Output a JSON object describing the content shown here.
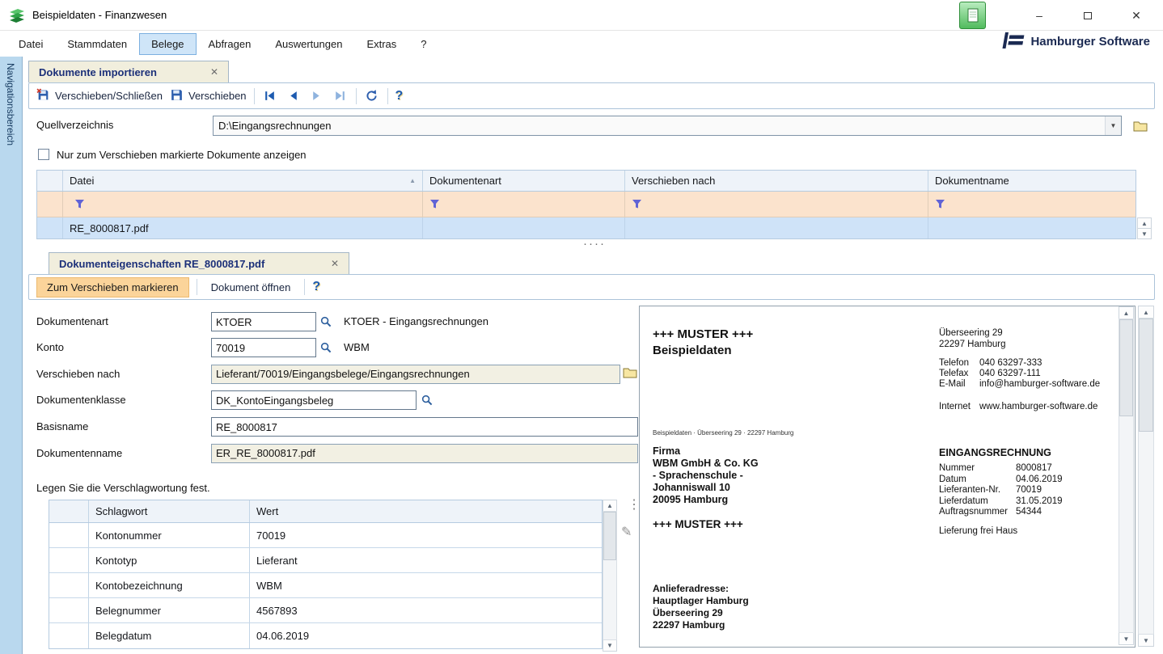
{
  "titlebar": {
    "title": "Beispieldaten - Finanzwesen"
  },
  "menubar": {
    "items": [
      "Datei",
      "Stammdaten",
      "Belege",
      "Abfragen",
      "Auswertungen",
      "Extras",
      "?"
    ]
  },
  "brand": {
    "name": "Hamburger Software"
  },
  "navigation": {
    "label": "Navigationsbereich"
  },
  "import_tab": {
    "title": "Dokumente importieren"
  },
  "toolbar": {
    "move_close_label": "Verschieben/Schließen",
    "move_label": "Verschieben"
  },
  "source_dir": {
    "label": "Quellverzeichnis",
    "value": "D:\\Eingangsrechnungen"
  },
  "show_marked_only": {
    "label": "Nur zum Verschieben markierte Dokumente anzeigen"
  },
  "documents_grid": {
    "columns": {
      "file": "Datei",
      "doc_type": "Dokumentenart",
      "move_to": "Verschieben nach",
      "doc_name": "Dokumentname"
    },
    "rows": [
      {
        "file": "RE_8000817.pdf",
        "doc_type": "",
        "move_to": "",
        "doc_name": ""
      }
    ]
  },
  "properties_tab": {
    "title": "Dokumenteigenschaften RE_8000817.pdf"
  },
  "properties_toolbar": {
    "mark_label": "Zum Verschieben markieren",
    "open_label": "Dokument öffnen"
  },
  "properties_form": {
    "doc_type": {
      "label": "Dokumentenart",
      "value": "KTOER",
      "description": "KTOER - Eingangsrechnungen"
    },
    "account": {
      "label": "Konto",
      "value": "70019",
      "description": "WBM"
    },
    "move_to": {
      "label": "Verschieben nach",
      "value": "Lieferant/70019/Eingangsbelege/Eingangsrechnungen"
    },
    "doc_class": {
      "label": "Dokumentenklasse",
      "value": "DK_KontoEingangsbeleg"
    },
    "base_name": {
      "label": "Basisname",
      "value": "RE_8000817"
    },
    "doc_name": {
      "label": "Dokumentenname",
      "value": "ER_RE_8000817.pdf"
    },
    "keywords_heading": "Legen Sie die Verschlagwortung fest."
  },
  "keywords_grid": {
    "columns": {
      "keyword": "Schlagwort",
      "value": "Wert"
    },
    "rows": [
      {
        "keyword": "Kontonummer",
        "value": "70019"
      },
      {
        "keyword": "Kontotyp",
        "value": "Lieferant"
      },
      {
        "keyword": "Kontobezeichnung",
        "value": "WBM"
      },
      {
        "keyword": "Belegnummer",
        "value": "4567893"
      },
      {
        "keyword": "Belegdatum",
        "value": "04.06.2019"
      }
    ]
  },
  "document_preview": {
    "watermark_top": "+++ MUSTER +++",
    "company": "Beispieldaten",
    "address": [
      "Überseering 29",
      "22297 Hamburg"
    ],
    "contact": [
      {
        "label": "Telefon",
        "value": "040 63297-333"
      },
      {
        "label": "Telefax",
        "value": "040 63297-111"
      },
      {
        "label": "E-Mail",
        "value": "info@hamburger-software.de"
      },
      {
        "label": "Internet",
        "value": "www.hamburger-software.de"
      }
    ],
    "sender_line": "Beispieldaten · Überseering 29 · 22297 Hamburg",
    "recipient": [
      "Firma",
      "WBM GmbH & Co. KG",
      "- Sprachenschule -",
      "Johanniswall 10",
      "20095 Hamburg"
    ],
    "watermark_mid": "+++ MUSTER +++",
    "invoice": {
      "title": "EINGANGSRECHNUNG",
      "fields": [
        {
          "label": "Nummer",
          "value": "8000817"
        },
        {
          "label": "Datum",
          "value": "04.06.2019"
        },
        {
          "label": "Lieferanten-Nr.",
          "value": "70019"
        },
        {
          "label": "Lieferdatum",
          "value": "31.05.2019"
        },
        {
          "label": "Auftragsnummer",
          "value": "54344"
        }
      ],
      "note": "Lieferung frei Haus"
    },
    "delivery_address": [
      "Anlieferadresse:",
      "Hauptlager Hamburg",
      "Überseering 29",
      "22297 Hamburg"
    ]
  },
  "icons": {
    "minimize": "–",
    "close": "✕",
    "tab_close": "✕",
    "dropdown": "▼",
    "sort_asc": "▲",
    "scroll_up": "▲",
    "scroll_down": "▼",
    "help": "?",
    "pencil": "✎",
    "grip": "⋮",
    "splitter_dots": "····"
  }
}
